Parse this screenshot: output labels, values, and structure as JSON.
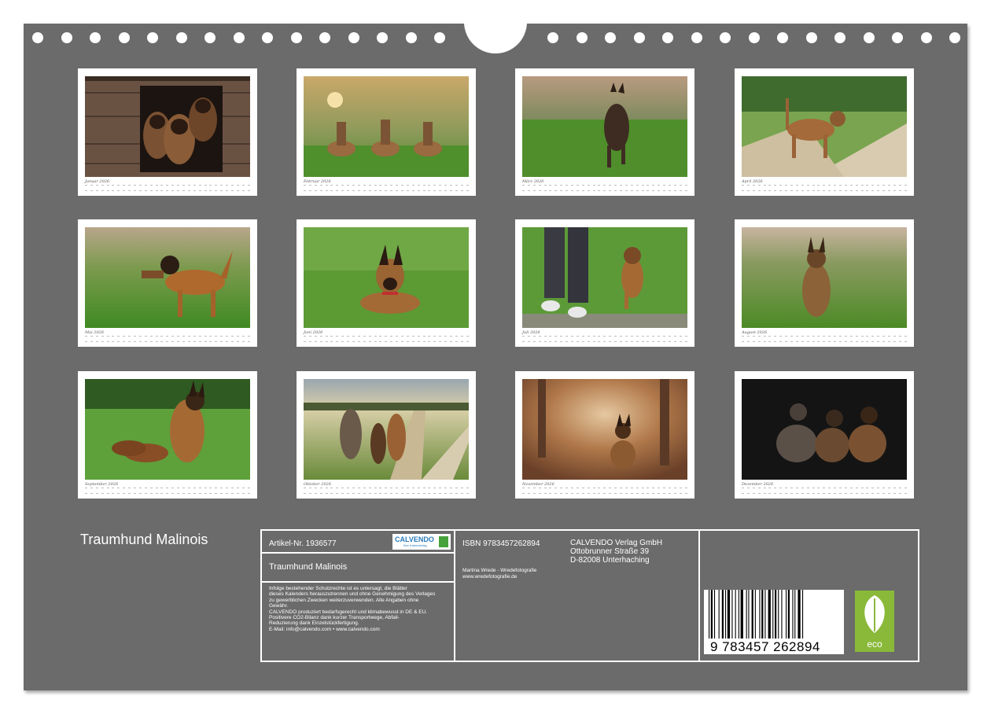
{
  "calendar": {
    "title": "Traumhund Malinois",
    "months": [
      {
        "label": "Januar 2026"
      },
      {
        "label": "Februar 2026"
      },
      {
        "label": "März 2026"
      },
      {
        "label": "April 2026"
      },
      {
        "label": "Mai 2026"
      },
      {
        "label": "Juni 2026"
      },
      {
        "label": "Juli 2026"
      },
      {
        "label": "August 2026"
      },
      {
        "label": "September 2026"
      },
      {
        "label": "Oktober 2026"
      },
      {
        "label": "November 2026"
      },
      {
        "label": "Dezember 2026"
      }
    ]
  },
  "info": {
    "article": "Artikel-Nr. 1936577",
    "logo_text": "CALVENDO",
    "logo_sub": "Ihre Kalendertag",
    "product_title": "Traumhund Malinois",
    "legal": [
      "Infolge bestehender Schutzrechte ist es untersagt, die Blätter",
      "dieses Kalenders herauszutrennen und ohne Genehmigung des Verlages",
      "zu gewerblichen Zwecken weiterzuverwenden. Alle Angaben ohne",
      "Gewähr.",
      "CALVENDO produziert bedarfsgerecht und klimabewusst in DE & EU.",
      "Positivere CO2-Bilanz dank kurzer Transportwege, Abfall-",
      "Reduzierung dank Einzelstückfertigung.",
      "E-Mail: info@calvendo.com • www.calvendo.com"
    ],
    "isbn": "ISBN 9783457262894",
    "author": "Martina Wrede - Wredefotografie",
    "author_web": "www.wredefotografie.de",
    "publisher": [
      "CALVENDO Verlag GmbH",
      "Ottobrunner Straße 39",
      "D-82008 Unterhaching"
    ],
    "barcode_number": "9 783457 262894",
    "eco_label": "eco"
  }
}
